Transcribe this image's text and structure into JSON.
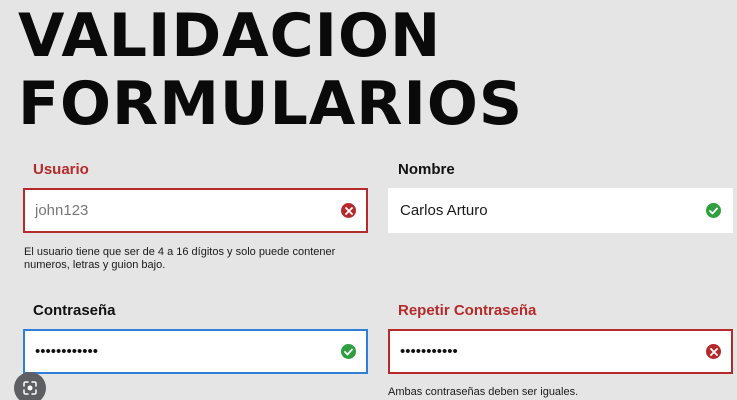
{
  "title": {
    "line1": "VALIDACION",
    "line2": "FORMULARIOS"
  },
  "usuario": {
    "label": "Usuario",
    "value": "john123",
    "status": "error",
    "help": "El usuario tiene que ser de 4 a 16 dígitos y solo puede contener numeros, letras y guion bajo."
  },
  "nombre": {
    "label": "Nombre",
    "value": "Carlos Arturo",
    "status": "valid"
  },
  "contrasena": {
    "label": "Contraseña",
    "value": "••••••••••••",
    "status": "valid"
  },
  "repetir": {
    "label": "Repetir Contraseña",
    "value": "•••••••••••",
    "status": "error",
    "help": "Ambas contraseñas deben ser iguales."
  },
  "colors": {
    "error": "#b52a2a",
    "valid": "#2e9e3f",
    "focus": "#2f7fd8",
    "background": "#e5e5e5"
  },
  "icons": {
    "error": "x-circle-icon",
    "valid": "check-circle-icon",
    "overlay": "lens-search-icon"
  }
}
